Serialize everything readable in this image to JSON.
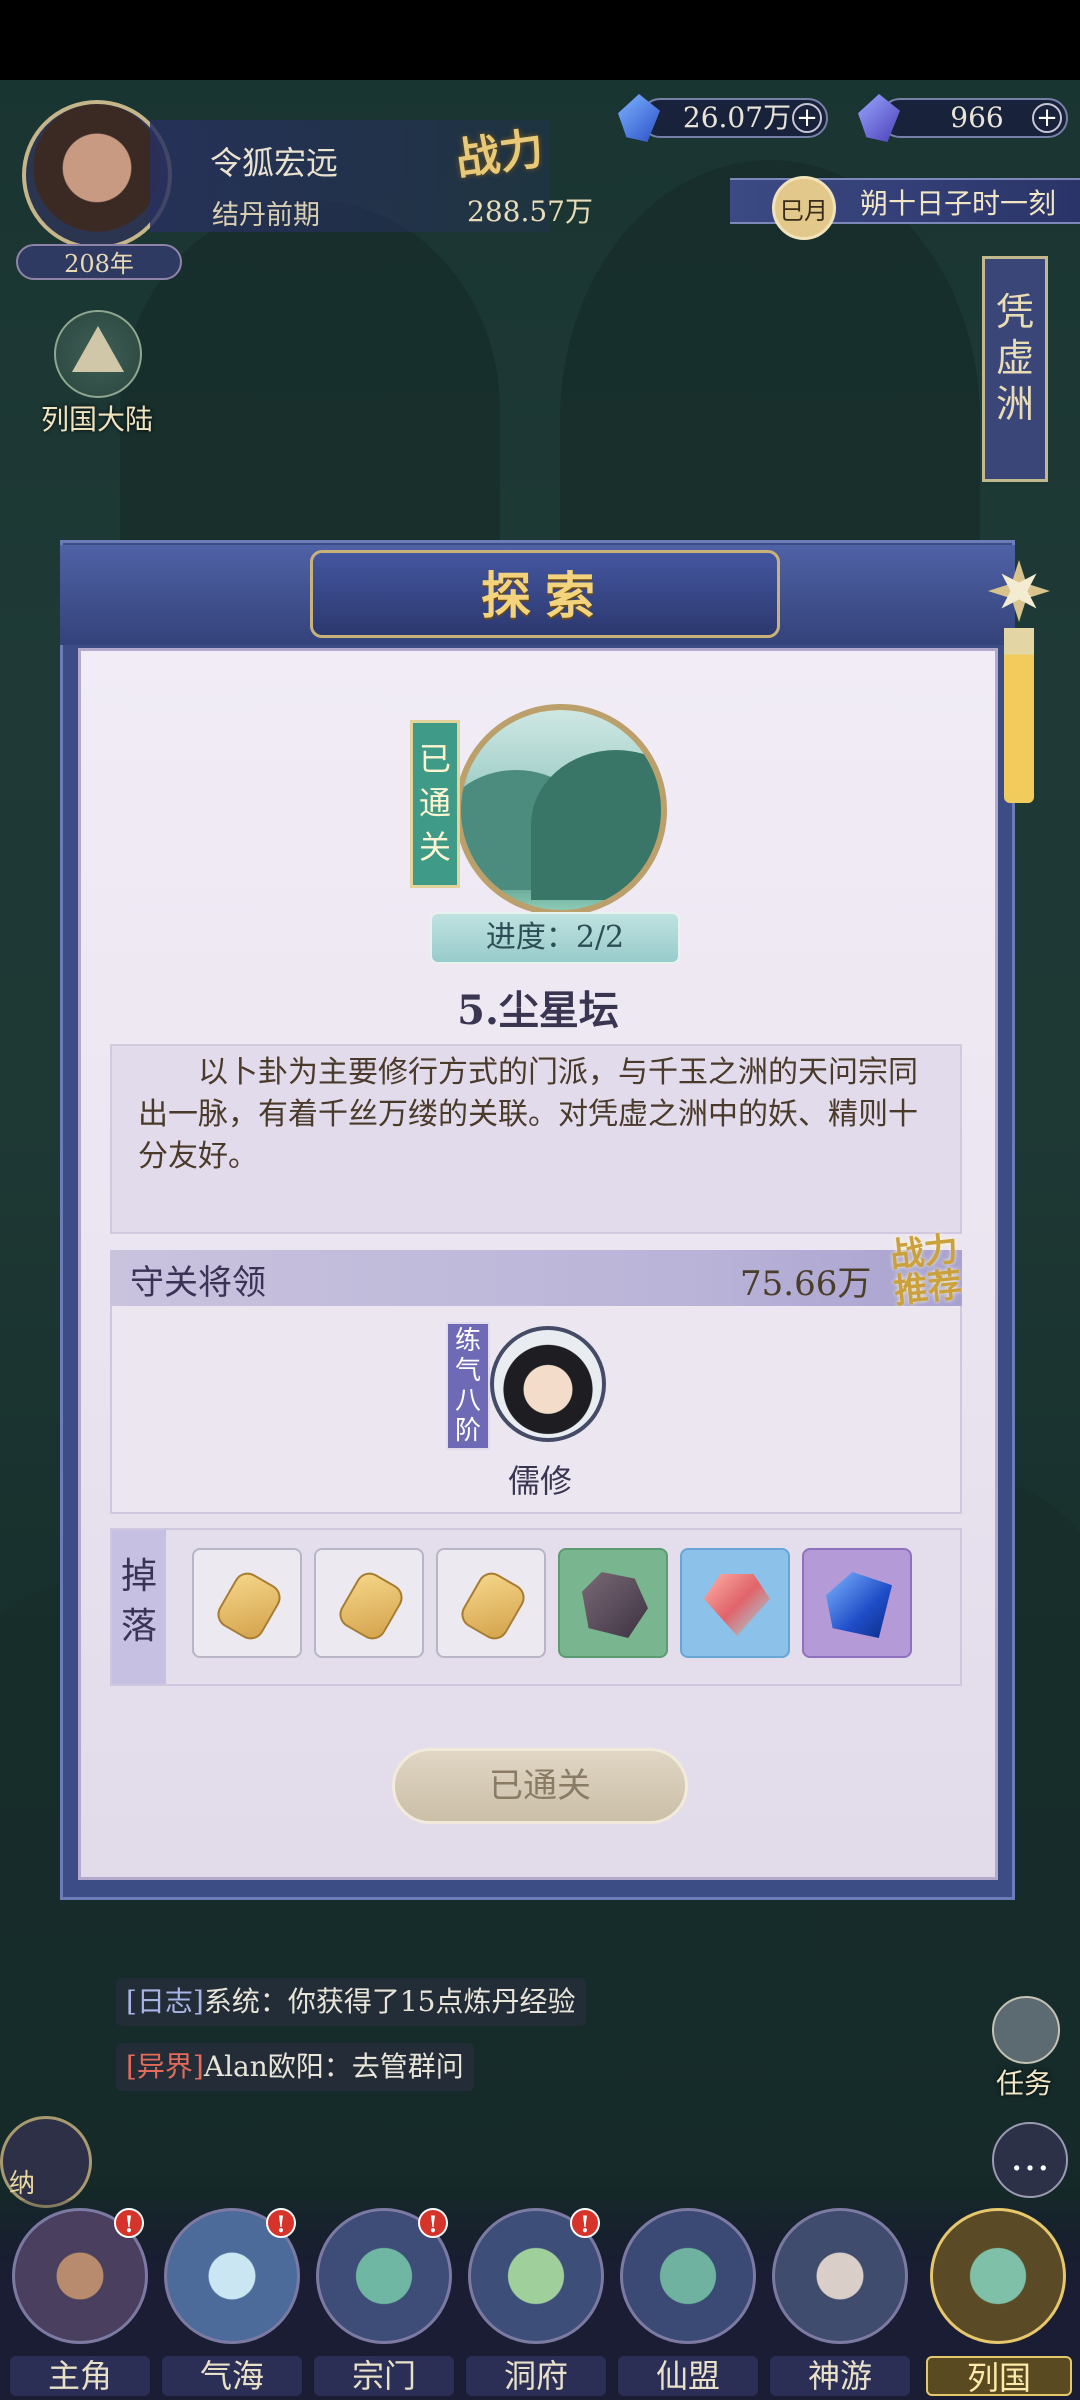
{
  "header": {
    "player_name": "令狐宏远",
    "realm": "结丹前期",
    "age": "208年",
    "power_label": "战力",
    "power_value": "288.57万",
    "resources": [
      {
        "icon": "spirit-stone-icon",
        "value": "26.07万"
      },
      {
        "icon": "jade-icon",
        "value": "966"
      }
    ],
    "time_badge": "巳月",
    "date_text": "朔十日子时一刻",
    "region": "凭虚洲",
    "world_button": "列国大陆"
  },
  "dialog": {
    "title": "探索",
    "cleared_tag": "已通关",
    "progress": "进度：2/2",
    "stage_name": "5.尘星坛",
    "description": "以卜卦为主要修行方式的门派，与千玉之洲的天问宗同出一脉，有着千丝万缕的关联。对凭虚之洲中的妖、精则十分友好。",
    "guard_section_title": "守关将领",
    "guard_power": "75.66万",
    "recommend_badge": "战力推荐",
    "guard": {
      "rank": "练气八阶",
      "name": "儒修"
    },
    "drops_label": "掉落",
    "drops": [
      {
        "icon": "token-icon",
        "rarity": "common"
      },
      {
        "icon": "token-icon",
        "rarity": "common"
      },
      {
        "icon": "token-icon",
        "rarity": "common"
      },
      {
        "icon": "ore-icon",
        "rarity": "green"
      },
      {
        "icon": "crystal-icon",
        "rarity": "blue"
      },
      {
        "icon": "sapphire-icon",
        "rarity": "purple"
      }
    ],
    "action_button": "已通关"
  },
  "chat_log": [
    {
      "tag": "[日志]",
      "text": "系统：你获得了15点炼丹经验"
    },
    {
      "tag": "[异界]",
      "text": "Alan欧阳：去管群问"
    }
  ],
  "side_buttons": {
    "task": "任务",
    "bag": "纳"
  },
  "nav": [
    {
      "label": "主角",
      "badge": "!"
    },
    {
      "label": "气海",
      "badge": "!"
    },
    {
      "label": "宗门",
      "badge": "!"
    },
    {
      "label": "洞府",
      "badge": "!"
    },
    {
      "label": "仙盟",
      "badge": ""
    },
    {
      "label": "神游",
      "badge": ""
    },
    {
      "label": "列国",
      "badge": ""
    }
  ],
  "colors": {
    "accent_gold": "#f3d47c",
    "panel_blue": "#3c4c85",
    "badge_red": "#d6332b"
  }
}
